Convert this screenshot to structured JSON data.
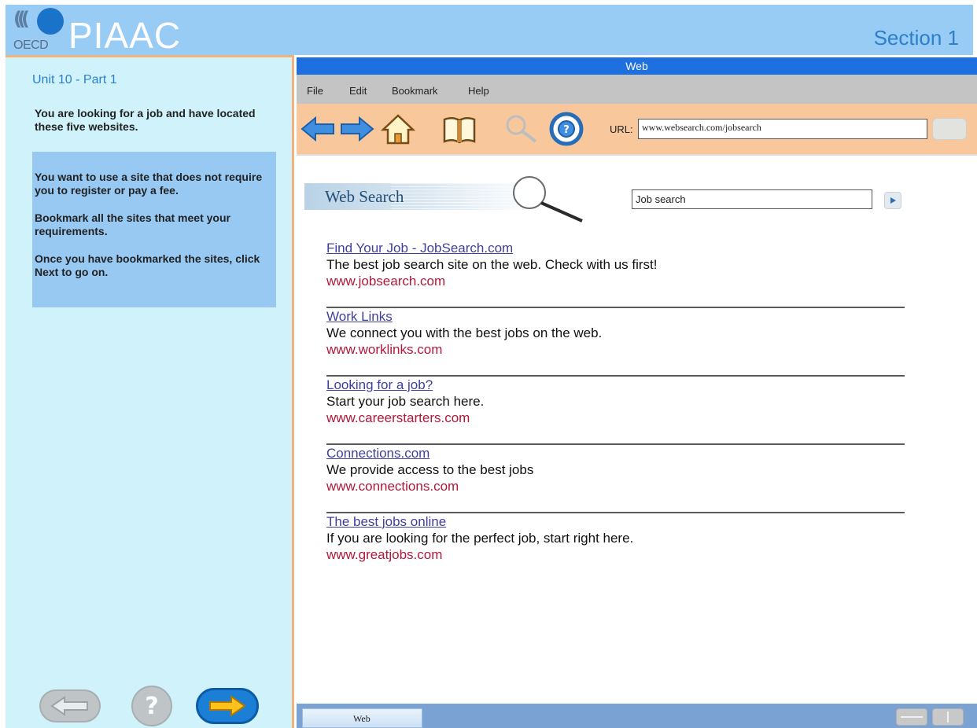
{
  "header": {
    "logo_org": "OECD",
    "logo_product": "PIAAC",
    "section": "Section 1"
  },
  "left_panel": {
    "unit_title": "Unit 10 - Part 1",
    "intro": "You are looking for a job and have located these five websites.",
    "task_paragraphs": [
      "You want to use a site that does not require you to register or pay a fee.",
      "Bookmark all the sites that meet your requirements.",
      "Once you have bookmarked the sites, click Next to go on."
    ],
    "nav_icons": [
      "back-arrow-icon",
      "help-icon",
      "next-arrow-icon"
    ]
  },
  "browser": {
    "window_title": "Web",
    "menu": [
      "File",
      "Edit",
      "Bookmark",
      "Help"
    ],
    "toolbar_icons": [
      "back-arrow-icon",
      "forward-arrow-icon",
      "home-icon",
      "bookmark-book-icon",
      "search-magnifier-icon",
      "help-lifebuoy-icon"
    ],
    "url_label": "URL:",
    "url_value": "www.websearch.com/jobsearch",
    "search_heading": "Web Search",
    "search_query": "Job search",
    "results": [
      {
        "title": "Find Your Job - JobSearch.com",
        "description": "The best job search site on the web.  Check with us first!",
        "url": "www.jobsearch.com"
      },
      {
        "title": "Work Links",
        "description": "We connect you with the best jobs on the web.",
        "url": "www.worklinks.com"
      },
      {
        "title": "Looking for a job?",
        "description": "Start your job search here.",
        "url": "www.careerstarters.com"
      },
      {
        "title": "Connections.com",
        "description": "We provide access to the best jobs",
        "url": "www.connections.com"
      },
      {
        "title": "The best jobs online",
        "description": "If you are looking for the perfect job, start right here.",
        "url": "www.greatjobs.com"
      }
    ],
    "status_tab": "Web"
  },
  "colors": {
    "banner": "#99ccf5",
    "left_panel": "#cff2fb",
    "task_box": "#97c9f3",
    "title_bar": "#1e6fe0",
    "toolbar": "#f8c89c",
    "link": "#3f3fa0",
    "result_url": "#b1183a"
  }
}
